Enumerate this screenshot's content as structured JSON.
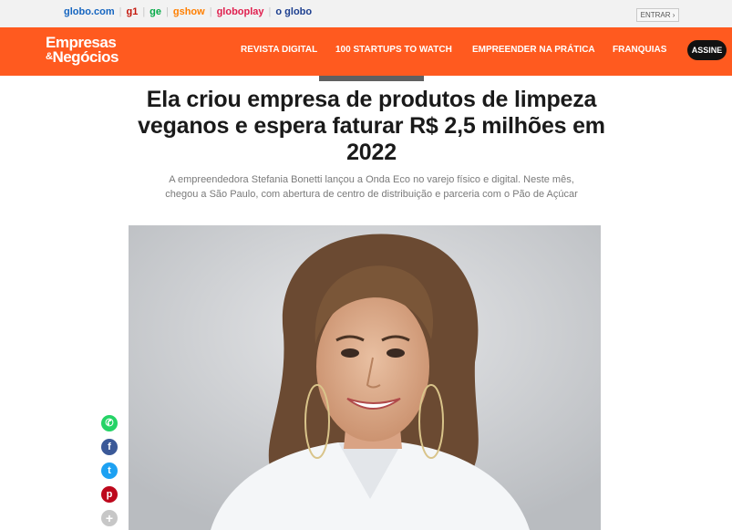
{
  "globo_bar": {
    "brands": [
      {
        "label": "globo.com",
        "color": "#1565c0"
      },
      {
        "label": "g1",
        "color": "#c4170c"
      },
      {
        "label": "ge",
        "color": "#06aa48"
      },
      {
        "label": "gshow",
        "color": "#ff7f00"
      },
      {
        "label": "globoplay",
        "color": "#e01f4e"
      },
      {
        "label": "o globo",
        "color": "#1d3f8f"
      }
    ],
    "entrar_label": "ENTRAR ›"
  },
  "header": {
    "logo_line1": "Empresas",
    "logo_line2": "Negócios",
    "logo_amp": "&",
    "nav": [
      "REVISTA DIGITAL",
      "100 STARTUPS TO WATCH",
      "EMPREENDER NA PRÁTICA",
      "FRANQUIAS"
    ],
    "assine_label": "ASSINE",
    "accent_color": "#ff5a1f"
  },
  "article": {
    "title": "Ela criou empresa de produtos de limpeza veganos e espera faturar R$ 2,5 milhões em 2022",
    "subtitle": "A empreendedora Stefania Bonetti lançou a Onda Eco no varejo físico e digital. Neste mês, chegou a São Paulo, com abertura de centro de distribuição e parceria com o Pão de Açúcar"
  },
  "social": [
    {
      "icon": "whatsapp-icon",
      "glyph": "✆",
      "color": "#25d366"
    },
    {
      "icon": "facebook-icon",
      "glyph": "f",
      "color": "#3b5998"
    },
    {
      "icon": "twitter-icon",
      "glyph": "t",
      "color": "#1da1f2"
    },
    {
      "icon": "pinterest-icon",
      "glyph": "p",
      "color": "#bd081c"
    },
    {
      "icon": "more-icon",
      "glyph": "+",
      "color": "#c7c7c7"
    }
  ]
}
